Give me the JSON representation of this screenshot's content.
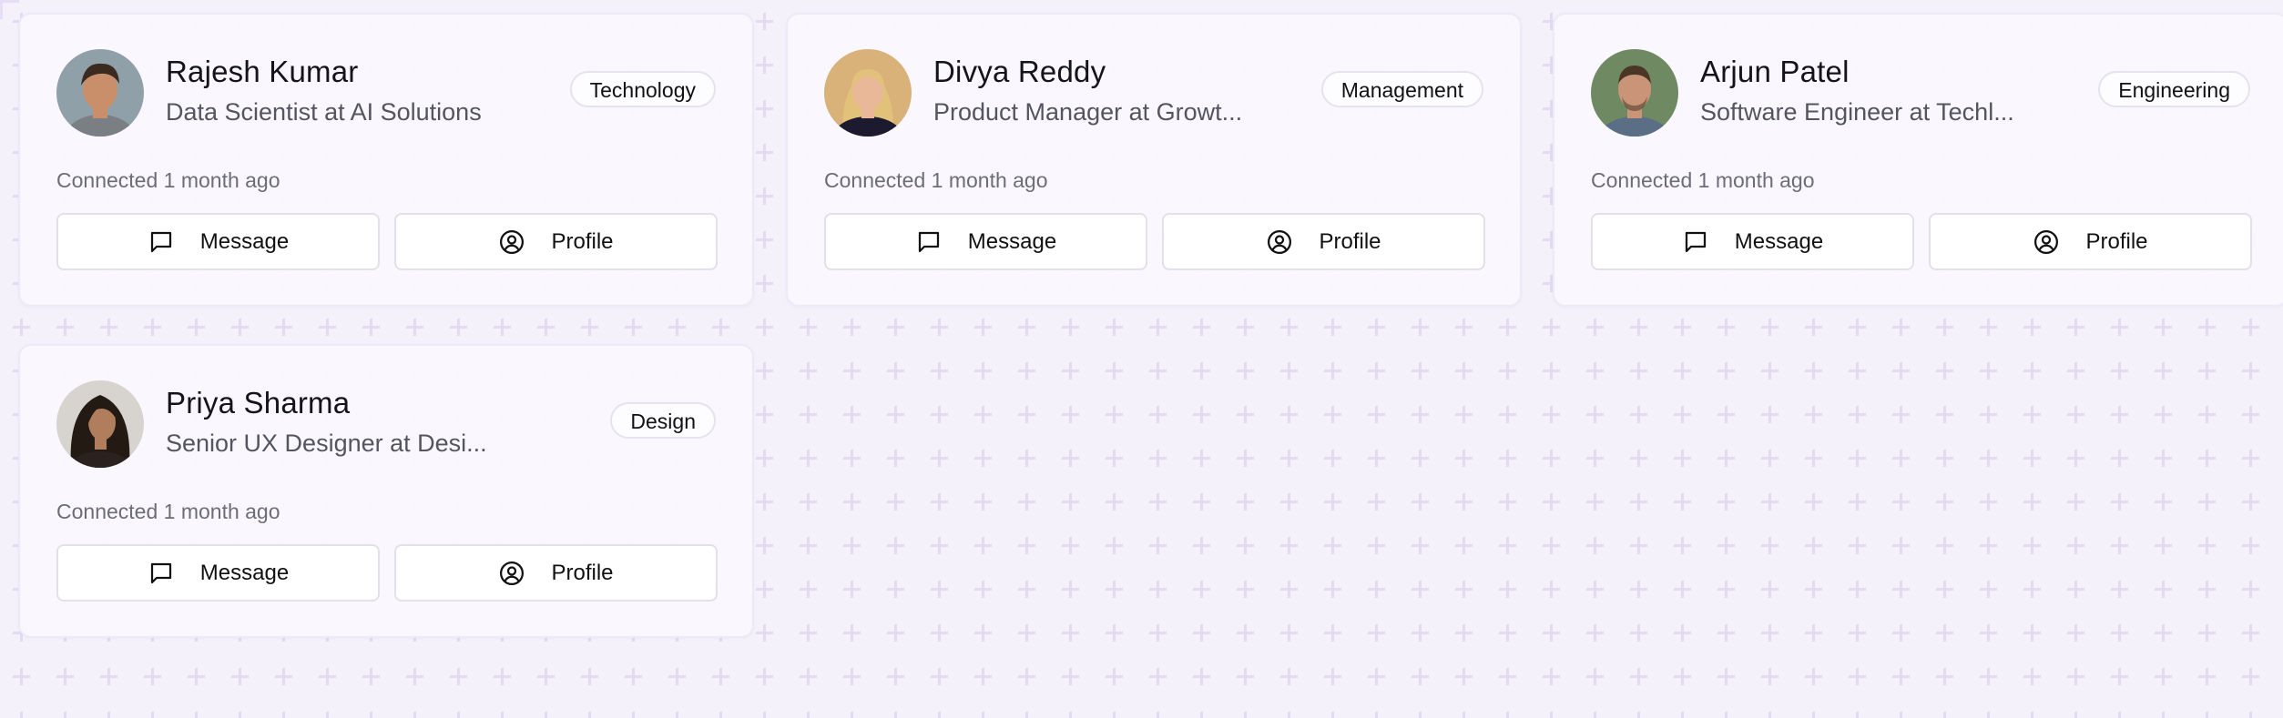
{
  "connections": [
    {
      "name": "Rajesh Kumar",
      "title": "Data Scientist at AI Solutions",
      "tag": "Technology",
      "connected": "Connected 1 month ago",
      "message_label": "Message",
      "profile_label": "Profile",
      "avatar": {
        "bg": "#8fa0a8",
        "skin": "#c98f6a",
        "hair": "#3a2a1f",
        "shirt": "#7a7f84"
      }
    },
    {
      "name": "Divya Reddy",
      "title": "Product Manager at Growt...",
      "tag": "Management",
      "connected": "Connected 1 month ago",
      "message_label": "Message",
      "profile_label": "Profile",
      "avatar": {
        "bg": "#d9b27a",
        "skin": "#e8b898",
        "hair": "#e2c27a",
        "shirt": "#1c1a2e"
      }
    },
    {
      "name": "Arjun Patel",
      "title": "Software Engineer at Techl...",
      "tag": "Engineering",
      "connected": "Connected 1 month ago",
      "message_label": "Message",
      "profile_label": "Profile",
      "avatar": {
        "bg": "#6f8a62",
        "skin": "#c99478",
        "hair": "#4a3626",
        "shirt": "#5a6f86"
      }
    },
    {
      "name": "Priya Sharma",
      "title": "Senior UX Designer at Desi...",
      "tag": "Design",
      "connected": "Connected 1 month ago",
      "message_label": "Message",
      "profile_label": "Profile",
      "avatar": {
        "bg": "#d7d4cf",
        "skin": "#b07e5c",
        "hair": "#231a14",
        "shirt": "#2b2220"
      }
    }
  ],
  "icons": {
    "message": "message-square-icon",
    "profile": "user-circle-icon"
  },
  "colors": {
    "background": "#f4f1fb",
    "pattern": "#e6def5",
    "card": "#faf7ff"
  }
}
